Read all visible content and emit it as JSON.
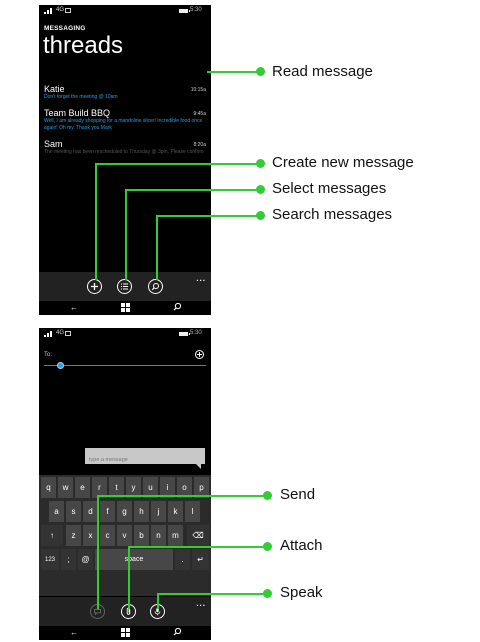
{
  "phone1": {
    "status": {
      "network": "4G",
      "time": "5:30"
    },
    "app_label": "MESSAGING",
    "page_title": "threads",
    "threads": [
      {
        "name": "Katie",
        "time": "10:15a",
        "snippet": "Don't forget the meeting @ 10am"
      },
      {
        "name": "Team Build BBQ",
        "time": "9:45a",
        "snippet": "Well, I am already shopping for a mandoline slicer! Incredible food once again! Oh my. Thank you Mark"
      },
      {
        "name": "Sam",
        "time": "8:20a",
        "snippet": "The meeting has been rescheduled to Thursday @ 3pm. Please confirm"
      }
    ],
    "appbar": {
      "more": "..."
    }
  },
  "phone2": {
    "status": {
      "network": "4G",
      "time": "5:30"
    },
    "to_label": "To:",
    "compose_placeholder": "type a message",
    "keyboard": {
      "row1": [
        "q",
        "w",
        "e",
        "r",
        "t",
        "y",
        "u",
        "i",
        "o",
        "p"
      ],
      "row2": [
        "a",
        "s",
        "d",
        "f",
        "g",
        "h",
        "j",
        "k",
        "l"
      ],
      "row3": [
        "z",
        "x",
        "c",
        "v",
        "b",
        "n",
        "m"
      ],
      "shift": "↑",
      "backspace": "⌫",
      "numbers": "123",
      "semicolon": ";",
      "emoji": "@",
      "space": "space",
      "period": ".",
      "enter": "↵"
    },
    "appbar": {
      "more": "..."
    }
  },
  "nav": {
    "back": "←"
  },
  "callouts": {
    "read": "Read message",
    "create": "Create new message",
    "select": "Select messages",
    "search": "Search messages",
    "send": "Send",
    "attach": "Attach",
    "speak": "Speak"
  },
  "colors": {
    "accent": "#1ba1e2",
    "callout": "#33cc33",
    "appbar": "#222222",
    "keyboard": "#2b2b2b",
    "key": "#474747"
  }
}
